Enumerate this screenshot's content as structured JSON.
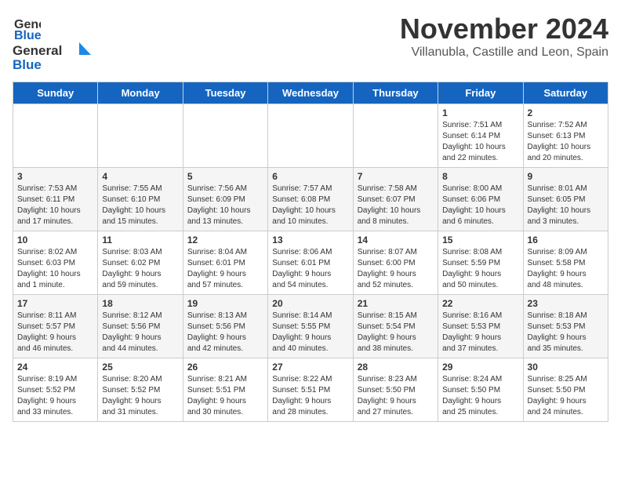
{
  "header": {
    "logo_line1": "General",
    "logo_line2": "Blue",
    "month": "November 2024",
    "location": "Villanubla, Castille and Leon, Spain"
  },
  "weekdays": [
    "Sunday",
    "Monday",
    "Tuesday",
    "Wednesday",
    "Thursday",
    "Friday",
    "Saturday"
  ],
  "weeks": [
    [
      {
        "day": "",
        "info": ""
      },
      {
        "day": "",
        "info": ""
      },
      {
        "day": "",
        "info": ""
      },
      {
        "day": "",
        "info": ""
      },
      {
        "day": "",
        "info": ""
      },
      {
        "day": "1",
        "info": "Sunrise: 7:51 AM\nSunset: 6:14 PM\nDaylight: 10 hours\nand 22 minutes."
      },
      {
        "day": "2",
        "info": "Sunrise: 7:52 AM\nSunset: 6:13 PM\nDaylight: 10 hours\nand 20 minutes."
      }
    ],
    [
      {
        "day": "3",
        "info": "Sunrise: 7:53 AM\nSunset: 6:11 PM\nDaylight: 10 hours\nand 17 minutes."
      },
      {
        "day": "4",
        "info": "Sunrise: 7:55 AM\nSunset: 6:10 PM\nDaylight: 10 hours\nand 15 minutes."
      },
      {
        "day": "5",
        "info": "Sunrise: 7:56 AM\nSunset: 6:09 PM\nDaylight: 10 hours\nand 13 minutes."
      },
      {
        "day": "6",
        "info": "Sunrise: 7:57 AM\nSunset: 6:08 PM\nDaylight: 10 hours\nand 10 minutes."
      },
      {
        "day": "7",
        "info": "Sunrise: 7:58 AM\nSunset: 6:07 PM\nDaylight: 10 hours\nand 8 minutes."
      },
      {
        "day": "8",
        "info": "Sunrise: 8:00 AM\nSunset: 6:06 PM\nDaylight: 10 hours\nand 6 minutes."
      },
      {
        "day": "9",
        "info": "Sunrise: 8:01 AM\nSunset: 6:05 PM\nDaylight: 10 hours\nand 3 minutes."
      }
    ],
    [
      {
        "day": "10",
        "info": "Sunrise: 8:02 AM\nSunset: 6:03 PM\nDaylight: 10 hours\nand 1 minute."
      },
      {
        "day": "11",
        "info": "Sunrise: 8:03 AM\nSunset: 6:02 PM\nDaylight: 9 hours\nand 59 minutes."
      },
      {
        "day": "12",
        "info": "Sunrise: 8:04 AM\nSunset: 6:01 PM\nDaylight: 9 hours\nand 57 minutes."
      },
      {
        "day": "13",
        "info": "Sunrise: 8:06 AM\nSunset: 6:01 PM\nDaylight: 9 hours\nand 54 minutes."
      },
      {
        "day": "14",
        "info": "Sunrise: 8:07 AM\nSunset: 6:00 PM\nDaylight: 9 hours\nand 52 minutes."
      },
      {
        "day": "15",
        "info": "Sunrise: 8:08 AM\nSunset: 5:59 PM\nDaylight: 9 hours\nand 50 minutes."
      },
      {
        "day": "16",
        "info": "Sunrise: 8:09 AM\nSunset: 5:58 PM\nDaylight: 9 hours\nand 48 minutes."
      }
    ],
    [
      {
        "day": "17",
        "info": "Sunrise: 8:11 AM\nSunset: 5:57 PM\nDaylight: 9 hours\nand 46 minutes."
      },
      {
        "day": "18",
        "info": "Sunrise: 8:12 AM\nSunset: 5:56 PM\nDaylight: 9 hours\nand 44 minutes."
      },
      {
        "day": "19",
        "info": "Sunrise: 8:13 AM\nSunset: 5:56 PM\nDaylight: 9 hours\nand 42 minutes."
      },
      {
        "day": "20",
        "info": "Sunrise: 8:14 AM\nSunset: 5:55 PM\nDaylight: 9 hours\nand 40 minutes."
      },
      {
        "day": "21",
        "info": "Sunrise: 8:15 AM\nSunset: 5:54 PM\nDaylight: 9 hours\nand 38 minutes."
      },
      {
        "day": "22",
        "info": "Sunrise: 8:16 AM\nSunset: 5:53 PM\nDaylight: 9 hours\nand 37 minutes."
      },
      {
        "day": "23",
        "info": "Sunrise: 8:18 AM\nSunset: 5:53 PM\nDaylight: 9 hours\nand 35 minutes."
      }
    ],
    [
      {
        "day": "24",
        "info": "Sunrise: 8:19 AM\nSunset: 5:52 PM\nDaylight: 9 hours\nand 33 minutes."
      },
      {
        "day": "25",
        "info": "Sunrise: 8:20 AM\nSunset: 5:52 PM\nDaylight: 9 hours\nand 31 minutes."
      },
      {
        "day": "26",
        "info": "Sunrise: 8:21 AM\nSunset: 5:51 PM\nDaylight: 9 hours\nand 30 minutes."
      },
      {
        "day": "27",
        "info": "Sunrise: 8:22 AM\nSunset: 5:51 PM\nDaylight: 9 hours\nand 28 minutes."
      },
      {
        "day": "28",
        "info": "Sunrise: 8:23 AM\nSunset: 5:50 PM\nDaylight: 9 hours\nand 27 minutes."
      },
      {
        "day": "29",
        "info": "Sunrise: 8:24 AM\nSunset: 5:50 PM\nDaylight: 9 hours\nand 25 minutes."
      },
      {
        "day": "30",
        "info": "Sunrise: 8:25 AM\nSunset: 5:50 PM\nDaylight: 9 hours\nand 24 minutes."
      }
    ]
  ]
}
